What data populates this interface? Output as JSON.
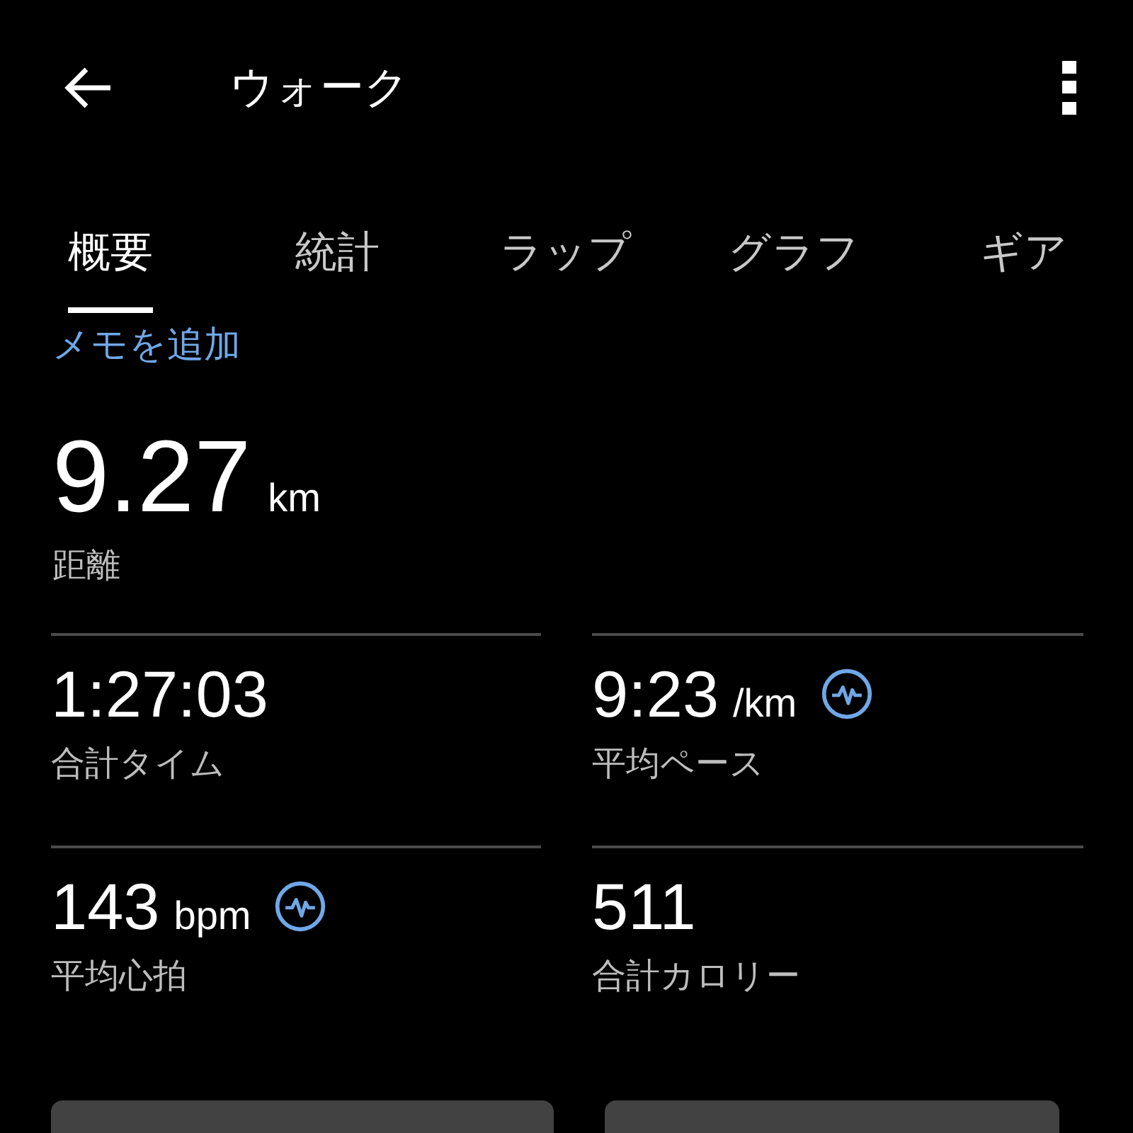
{
  "header": {
    "title": "ウォーク"
  },
  "tabs": [
    {
      "label": "概要",
      "selected": true
    },
    {
      "label": "統計",
      "selected": false
    },
    {
      "label": "ラップ",
      "selected": false
    },
    {
      "label": "グラフ",
      "selected": false
    },
    {
      "label": "ギア",
      "selected": false
    }
  ],
  "add_note_link": "メモを追加",
  "distance": {
    "value": "9.27",
    "unit": "km",
    "label": "距離"
  },
  "stats": [
    {
      "value": "1:27:03",
      "label": "合計タイム",
      "graph_badge": false
    },
    {
      "value": "9:23",
      "unit": "/km",
      "label": "平均ペース",
      "graph_badge": true
    },
    {
      "value": "143",
      "unit": "bpm",
      "label": "平均心拍",
      "graph_badge": true
    },
    {
      "value": "511",
      "label": "合計カロリー",
      "graph_badge": false
    }
  ]
}
